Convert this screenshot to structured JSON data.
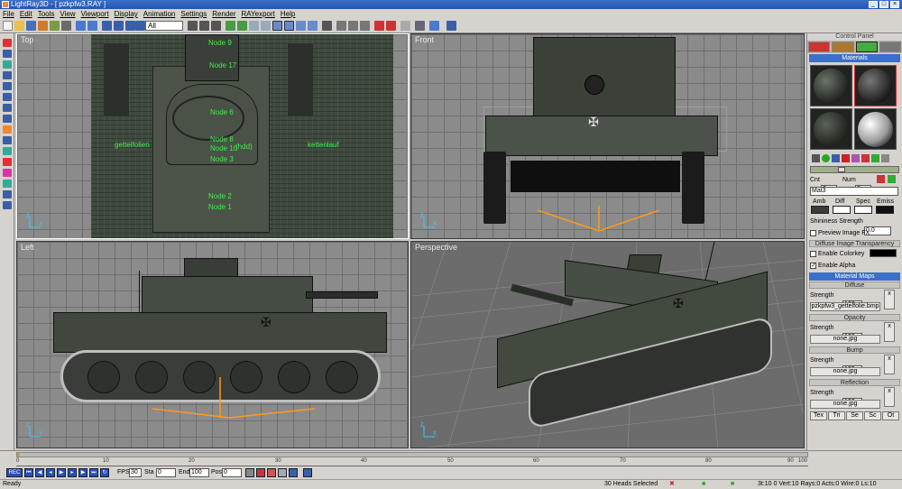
{
  "window": {
    "title": "LightRay3D - [ pzkpfw3.RAY ]"
  },
  "menu": [
    "File",
    "Edit",
    "Tools",
    "View",
    "Viewport",
    "Display",
    "Animation",
    "Settings",
    "Render",
    "RAYexport",
    "Help"
  ],
  "toolbar": {
    "select_value": "All"
  },
  "viewports": {
    "top": {
      "label": "Top"
    },
    "front": {
      "label": "Front"
    },
    "left": {
      "label": "Left"
    },
    "perspective": {
      "label": "Perspective"
    }
  },
  "top_nodes": [
    "Node 9",
    "Node 17",
    "Node 6",
    "Node 8",
    "Node 10",
    "Node 3",
    "Node 2",
    "Node 1",
    "gettelfolien",
    "kettenlauf",
    "(hdd)"
  ],
  "panel": {
    "header": "Control Panel",
    "materials_title": "Materials",
    "count_label": "Cnt",
    "count_value": "3",
    "num_label": "Num",
    "num_value": "3",
    "material_name": "Mat3",
    "color_labels": [
      "Amb",
      "Diff",
      "Spec",
      "Emiss"
    ],
    "shininess_label": "Shininess Strength",
    "shininess_value": "0.0",
    "preview_label": "Preview Image FX",
    "transparency_title": "Diffuse Image Transparency",
    "enable_colorkey": "Enable Colorkey",
    "enable_alpha": "Enable Alpha",
    "maps_title": "Material Maps",
    "diffuse": {
      "title": "Diffuse",
      "strength_label": "Strength",
      "strength_value": "100",
      "file": "pzkpfw3_gettelfolie.bmp"
    },
    "opacity": {
      "title": "Opacity",
      "strength_label": "Strength",
      "strength_value": "100",
      "file": "none.jpg"
    },
    "bump": {
      "title": "Bump",
      "strength_label": "Strength",
      "strength_value": "100",
      "file": "none.jpg"
    },
    "reflection": {
      "title": "Reflection",
      "strength_label": "Strength",
      "strength_value": "100",
      "file": "none.jpg"
    },
    "bottom_tabs": [
      "Tex",
      "Tri",
      "Se",
      "Sc",
      "Ot"
    ]
  },
  "timeline": {
    "ticks": [
      "0",
      "10",
      "20",
      "30",
      "40",
      "50",
      "60",
      "70",
      "80",
      "90",
      "100"
    ]
  },
  "anim": {
    "rec": "REC",
    "fps_label": "FPS",
    "fps_value": "30",
    "start_label": "Sta",
    "start_value": "0",
    "end_label": "End",
    "end_value": "100",
    "pos_label": "Pos",
    "pos_value": "0"
  },
  "status": {
    "left": "Ready",
    "middle": "30 Heads Selected",
    "coords": "3t:10 0 Vert:10 Rays:0 Acts:0 Wire:0 Ls:10"
  },
  "colors": {
    "accent": "#3c6fc8",
    "node_label": "#3cf04a"
  }
}
